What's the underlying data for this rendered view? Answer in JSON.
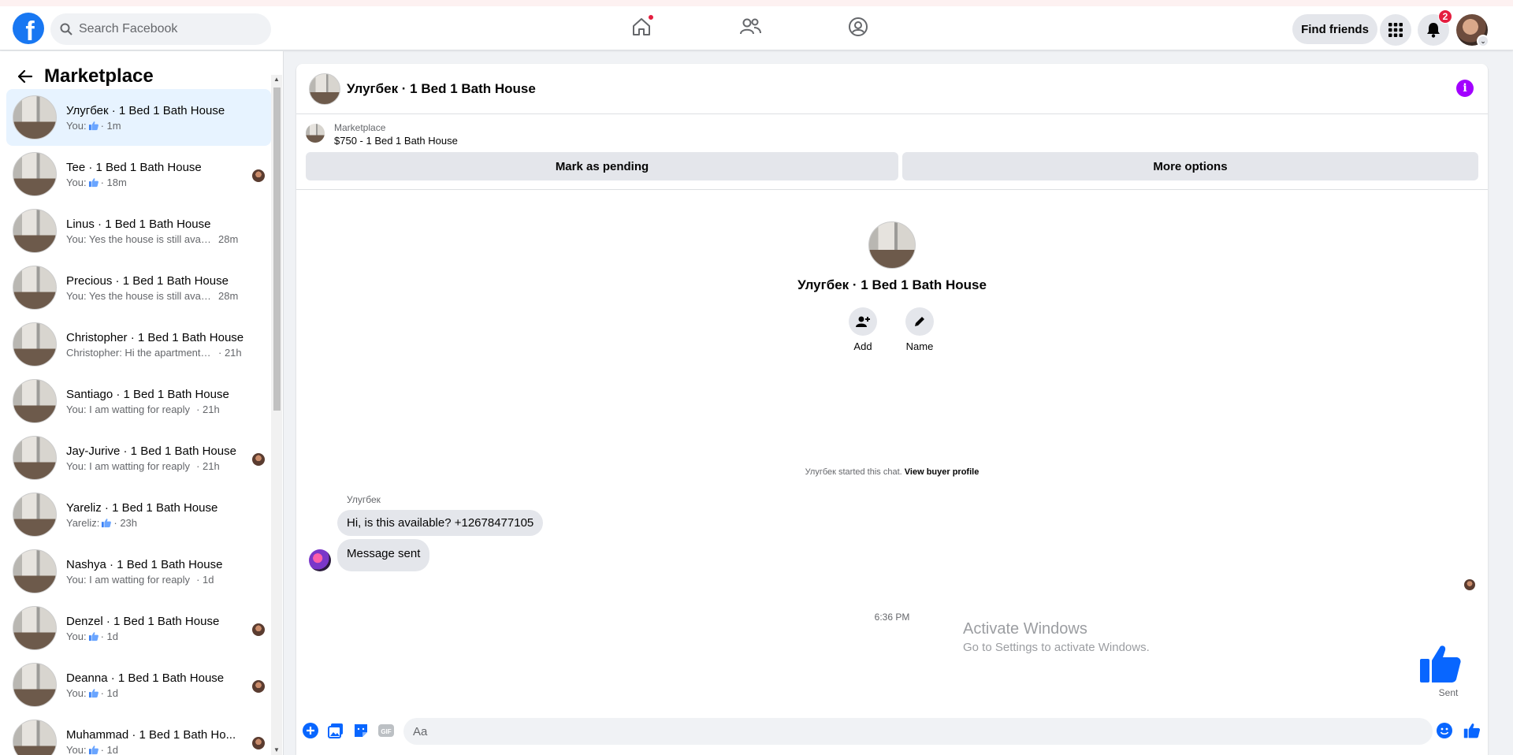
{
  "topnav": {
    "logo_letter": "f",
    "search_placeholder": "Search Facebook",
    "find_friends_label": "Find friends",
    "notification_count": "2",
    "brand_color": "#1877f2"
  },
  "left_panel": {
    "title": "Marketplace",
    "conversations": [
      {
        "title": "Улугбек · 1 Bed 1 Bath House",
        "preview": "You:",
        "like": true,
        "time": "· 1m",
        "seen": false
      },
      {
        "title": "Tee · 1 Bed 1 Bath House",
        "preview": "You:",
        "like": true,
        "time": "· 18m",
        "seen": true
      },
      {
        "title": "Linus · 1 Bed 1 Bath House",
        "preview": "You: Yes the house is still availabl...",
        "like": false,
        "time": "28m",
        "seen": false
      },
      {
        "title": "Precious · 1 Bed 1 Bath House",
        "preview": "You: Yes the house is still availabl...",
        "like": false,
        "time": "28m",
        "seen": false
      },
      {
        "title": "Christopher · 1 Bed 1 Bath House",
        "preview": "Christopher: Hi the apartment is f...",
        "like": false,
        "time": "· 21h",
        "seen": false
      },
      {
        "title": "Santiago · 1 Bed 1 Bath House",
        "preview": "You: I am watting for reaply",
        "like": false,
        "time": "· 21h",
        "seen": false
      },
      {
        "title": "Jay-Jurive · 1 Bed 1 Bath House",
        "preview": "You: I am watting for reaply",
        "like": false,
        "time": "· 21h",
        "seen": true
      },
      {
        "title": "Yareliz · 1 Bed 1 Bath House",
        "preview": "Yareliz:",
        "like": true,
        "time": "· 23h",
        "seen": false
      },
      {
        "title": "Nashya · 1 Bed 1 Bath House",
        "preview": "You: I am watting for reaply",
        "like": false,
        "time": "· 1d",
        "seen": false
      },
      {
        "title": "Denzel · 1 Bed 1 Bath House",
        "preview": "You:",
        "like": true,
        "time": "· 1d",
        "seen": true
      },
      {
        "title": "Deanna · 1 Bed 1 Bath House",
        "preview": "You:",
        "like": true,
        "time": "· 1d",
        "seen": true
      },
      {
        "title": "Muhammad · 1 Bed 1 Bath Ho...",
        "preview": "You:",
        "like": true,
        "time": "· 1d",
        "seen": true
      }
    ]
  },
  "chat": {
    "header_title": "Улугбек · 1 Bed 1 Bath House",
    "info_glyph": "i",
    "info_color": "#a200ff",
    "marketplace_label": "Marketplace",
    "listing": "$750 - 1 Bed 1 Bath House",
    "mark_pending_label": "Mark as pending",
    "more_options_label": "More options",
    "profile_name": "Улугбек · 1 Bed 1 Bath House",
    "add_label": "Add",
    "name_label": "Name",
    "started_text": "Улугбек started this chat.",
    "view_buyer_profile": "View buyer profile",
    "sender_name": "Улугбек",
    "messages": [
      "Hi, is this available? +12678477105",
      "Message sent"
    ],
    "timestamp": "6:36 PM",
    "sent_label": "Sent",
    "composer_placeholder": "Aa",
    "accent_color": "#0866ff"
  },
  "watermark": {
    "title": "Activate Windows",
    "subtitle": "Go to Settings to activate Windows."
  }
}
